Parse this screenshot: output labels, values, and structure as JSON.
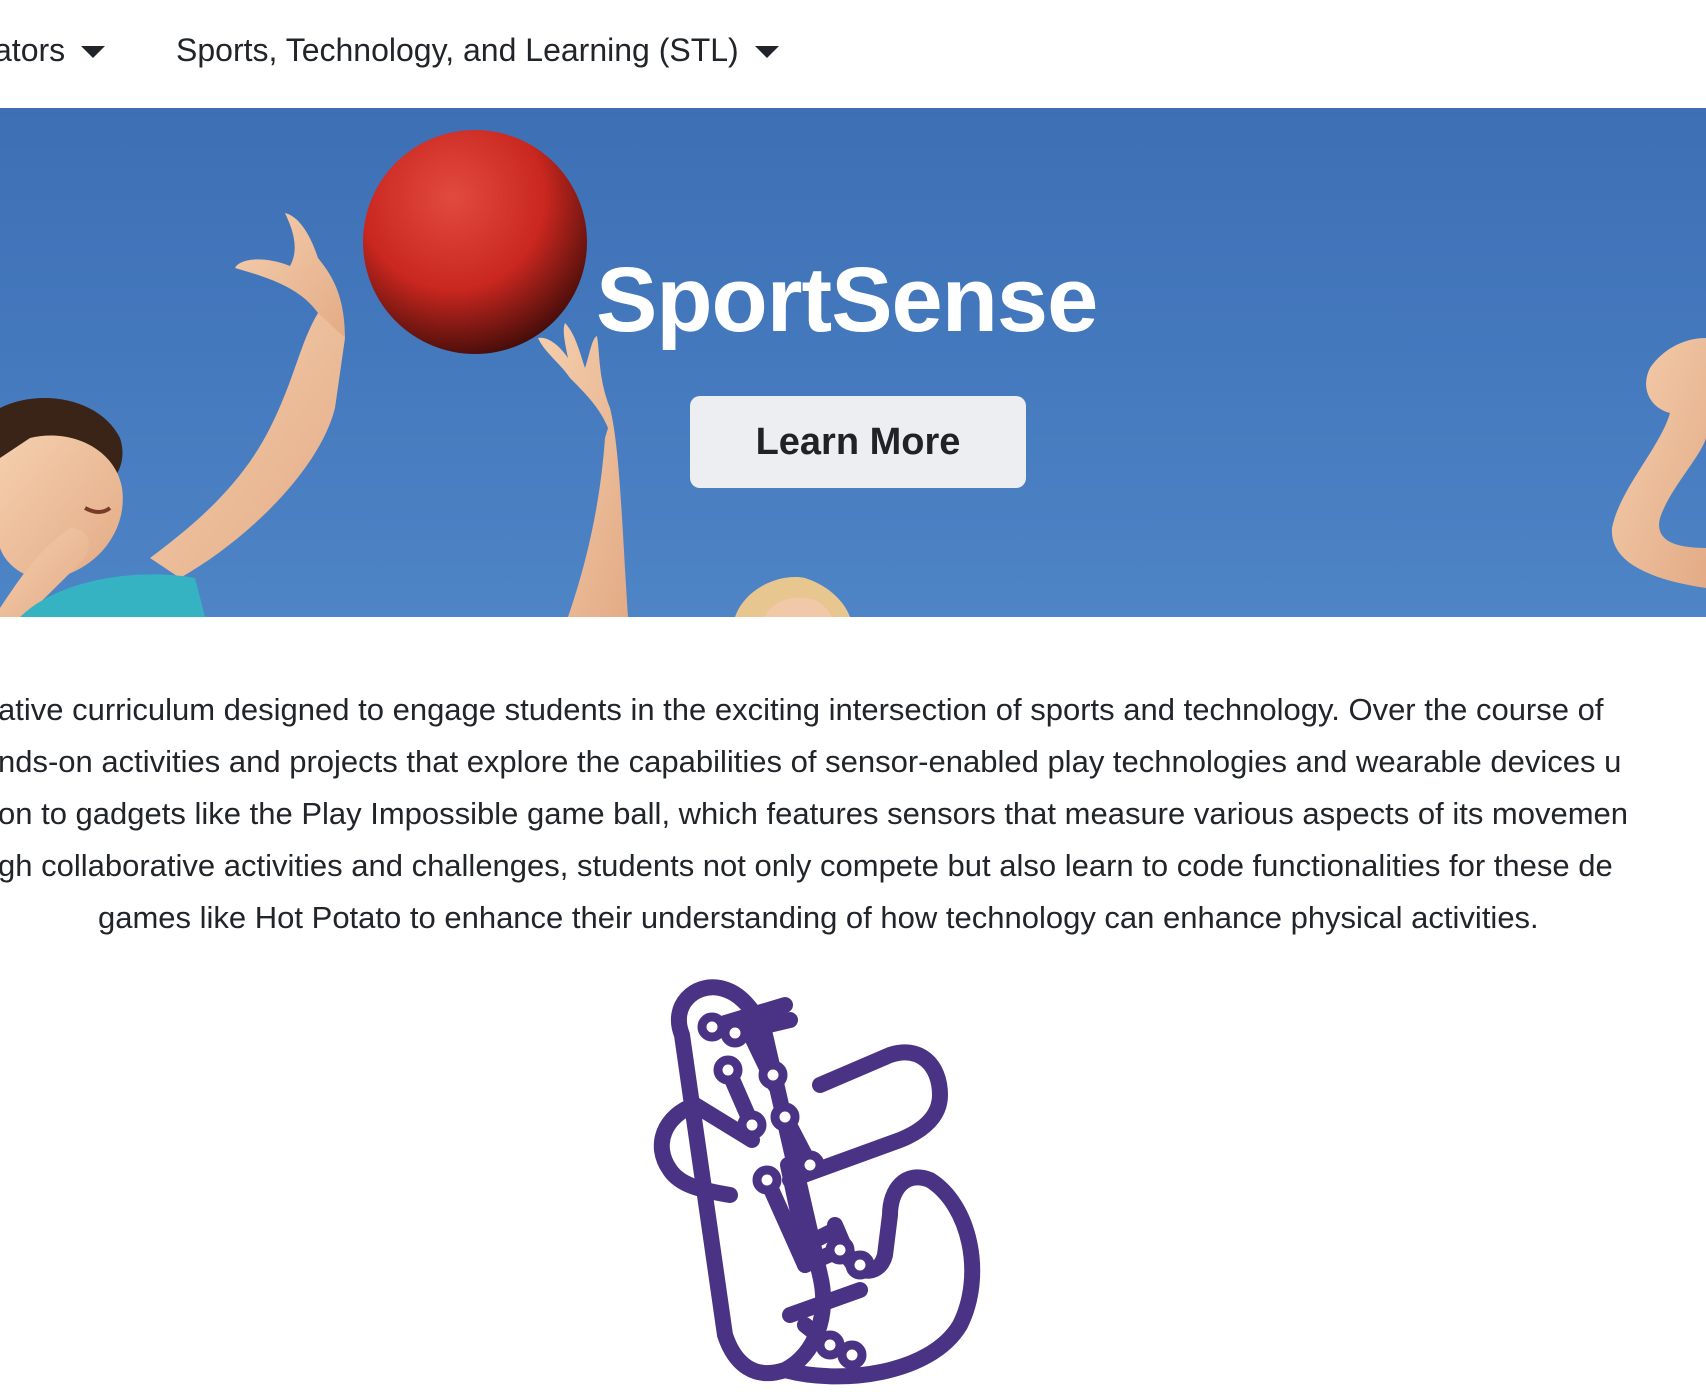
{
  "nav": {
    "items": [
      {
        "label": "cators"
      },
      {
        "label": "Sports, Technology, and Learning (STL)"
      }
    ]
  },
  "hero": {
    "title": "SportSense",
    "button_label": "Learn More",
    "colors": {
      "sky": "#4478bd",
      "ball": "#d32f2f",
      "button_bg": "#eceef2"
    }
  },
  "description": {
    "lines": [
      "ative curriculum designed to engage students in the exciting intersection of sports and technology. Over the course of",
      "nds-on activities and projects that explore the capabilities of sensor-enabled play technologies and wearable devices u",
      "on to gadgets like the Play Impossible game ball, which features sensors that measure various aspects of its movemen",
      "gh collaborative activities and challenges, students not only compete but also learn to code functionalities for these de",
      "games like Hot Potato to enhance their understanding of how technology can enhance physical activities."
    ]
  },
  "logo": {
    "icon": "circuit-hand-logo-icon",
    "color": "#4a3384"
  }
}
